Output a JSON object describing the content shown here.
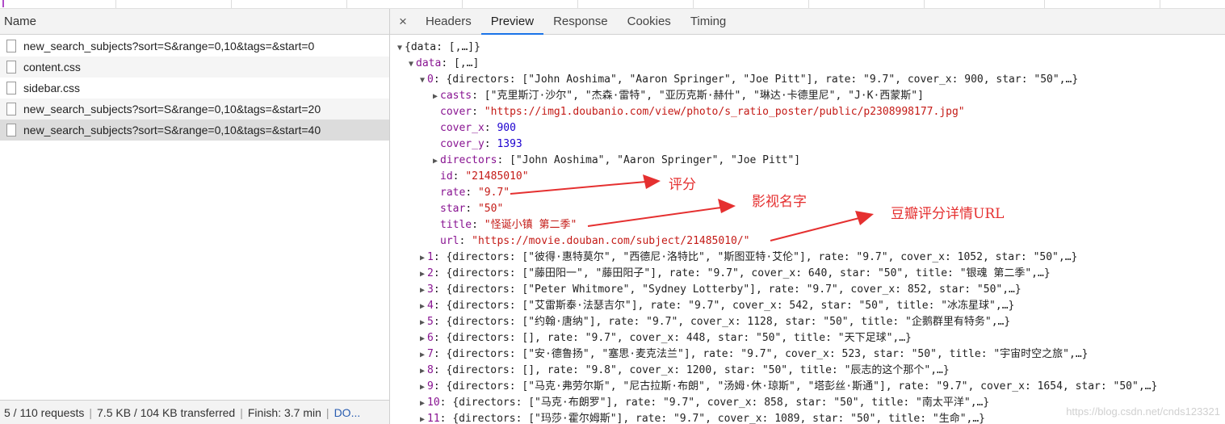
{
  "network": {
    "column_header": "Name",
    "requests": [
      {
        "name": "new_search_subjects?sort=S&range=0,10&tags=&start=0"
      },
      {
        "name": "content.css"
      },
      {
        "name": "sidebar.css"
      },
      {
        "name": "new_search_subjects?sort=S&range=0,10&tags=&start=20"
      },
      {
        "name": "new_search_subjects?sort=S&range=0,10&tags=&start=40"
      }
    ],
    "status": {
      "requests": "5 / 110 requests",
      "transferred": "7.5 KB / 104 KB transferred",
      "finish": "Finish: 3.7 min",
      "more": "DO..."
    }
  },
  "detail": {
    "close_glyph": "×",
    "tabs": [
      "Headers",
      "Preview",
      "Response",
      "Cookies",
      "Timing"
    ],
    "active_tab": "Preview"
  },
  "preview": {
    "root": "{data: [,…]}",
    "data_key": "data",
    "data_summary": "[,…]",
    "item0": {
      "index": "0",
      "summary": "{directors: [\"John Aoshima\", \"Aaron Springer\", \"Joe Pitt\"], rate: \"9.7\", cover_x: 900, star: \"50\",…}",
      "fields": {
        "casts": "[\"克里斯汀·沙尔\", \"杰森·雷特\", \"亚历克斯·赫什\", \"琳达·卡德里尼\", \"J·K·西蒙斯\"]",
        "cover": "\"https://img1.doubanio.com/view/photo/s_ratio_poster/public/p2308998177.jpg\"",
        "cover_x": "900",
        "cover_y": "1393",
        "directors": "[\"John Aoshima\", \"Aaron Springer\", \"Joe Pitt\"]",
        "id": "\"21485010\"",
        "rate": "\"9.7\"",
        "star": "\"50\"",
        "title": "\"怪诞小镇 第二季\"",
        "url": "\"https://movie.douban.com/subject/21485010/\""
      }
    },
    "items": [
      {
        "index": "1",
        "summary": "{directors: [\"彼得·惠特莫尔\", \"西德尼·洛特比\", \"斯图亚特·艾伦\"], rate: \"9.7\", cover_x: 1052, star: \"50\",…}"
      },
      {
        "index": "2",
        "summary": "{directors: [\"藤田阳一\", \"藤田阳子\"], rate: \"9.7\", cover_x: 640, star: \"50\", title: \"银魂 第二季\",…}"
      },
      {
        "index": "3",
        "summary": "{directors: [\"Peter Whitmore\", \"Sydney Lotterby\"], rate: \"9.7\", cover_x: 852, star: \"50\",…}"
      },
      {
        "index": "4",
        "summary": "{directors: [\"艾雷斯泰·法瑟吉尔\"], rate: \"9.7\", cover_x: 542, star: \"50\", title: \"冰冻星球\",…}"
      },
      {
        "index": "5",
        "summary": "{directors: [\"约翰·唐纳\"], rate: \"9.7\", cover_x: 1128, star: \"50\", title: \"企鹅群里有特务\",…}"
      },
      {
        "index": "6",
        "summary": "{directors: [], rate: \"9.7\", cover_x: 448, star: \"50\", title: \"天下足球\",…}"
      },
      {
        "index": "7",
        "summary": "{directors: [\"安·德鲁扬\", \"塞思·麦克法兰\"], rate: \"9.7\", cover_x: 523, star: \"50\", title: \"宇宙时空之旅\",…}"
      },
      {
        "index": "8",
        "summary": "{directors: [], rate: \"9.8\", cover_x: 1200, star: \"50\", title: \"辰志的这个那个\",…}"
      },
      {
        "index": "9",
        "summary": "{directors: [\"马克·弗劳尔斯\", \"尼古拉斯·布朗\", \"汤姆·休·琼斯\", \"塔彭丝·斯通\"], rate: \"9.7\", cover_x: 1654, star: \"50\",…}"
      },
      {
        "index": "10",
        "summary": "{directors: [\"马克·布朗罗\"], rate: \"9.7\", cover_x: 858, star: \"50\", title: \"南太平洋\",…}"
      },
      {
        "index": "11",
        "summary": "{directors: [\"玛莎·霍尔姆斯\"], rate: \"9.7\", cover_x: 1089, star: \"50\", title: \"生命\",…}"
      }
    ]
  },
  "annotations": {
    "rating": "评分",
    "title_name": "影视名字",
    "detail_url": "豆瓣评分详情URL",
    "color": "#e53030"
  },
  "watermark": "https://blog.csdn.net/cnds123321"
}
